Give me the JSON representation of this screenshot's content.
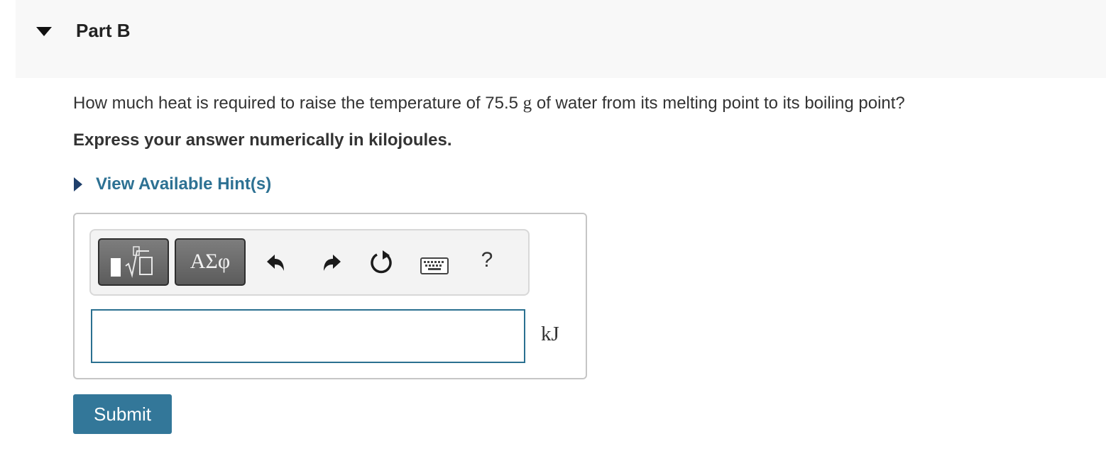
{
  "part": {
    "title": "Part B"
  },
  "question": {
    "text_before": "How much heat is required to raise the temperature of 75.5 ",
    "unit_symbol": "g",
    "text_after": " of water from its melting point to its boiling point?"
  },
  "instruction": "Express your answer numerically in kilojoules.",
  "hint": {
    "label": "View Available Hint(s)"
  },
  "toolbar": {
    "symbols_label": "ΑΣφ",
    "help_label": "?",
    "icons": [
      "templates-icon",
      "undo-icon",
      "redo-icon",
      "reset-icon",
      "keyboard-icon"
    ]
  },
  "answer": {
    "value": "",
    "unit": "kJ"
  },
  "submit_label": "Submit",
  "colors": {
    "accent": "#337799",
    "link": "#2d7193",
    "header_bg": "#f8f8f8",
    "input_border": "#2a7090"
  }
}
